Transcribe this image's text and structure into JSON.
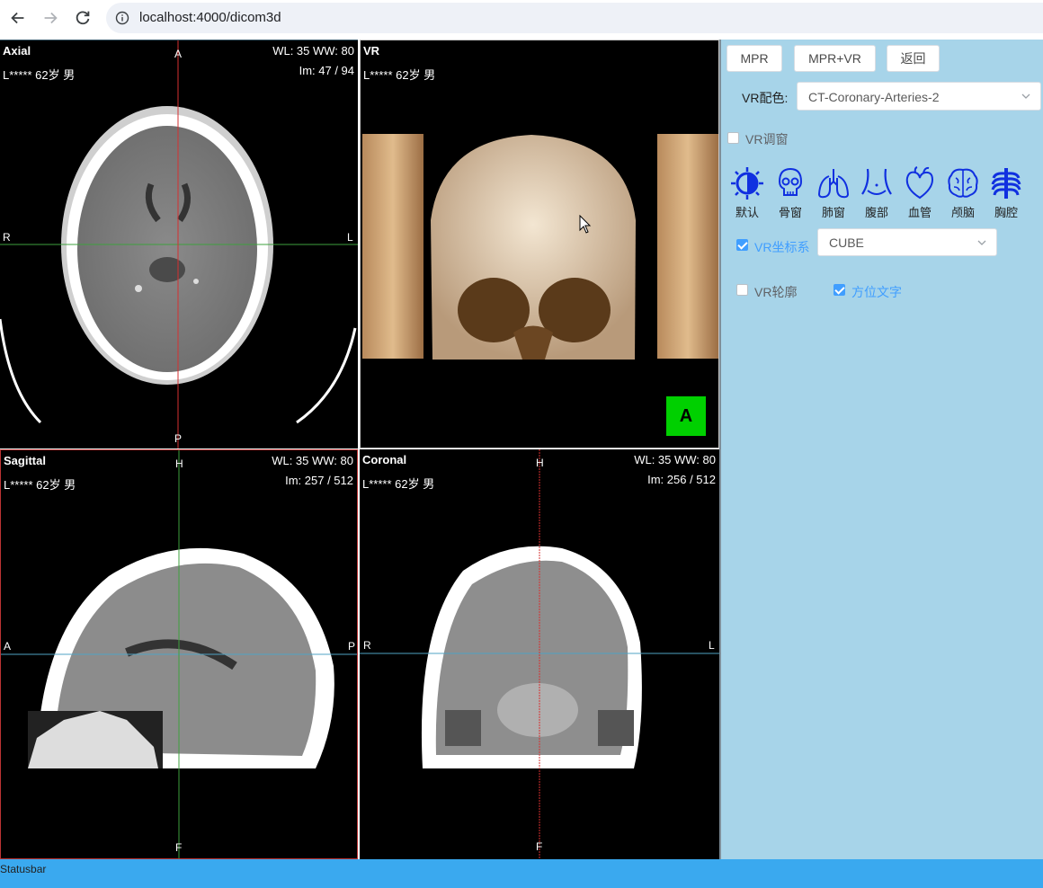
{
  "browser": {
    "url": "localhost:4000/dicom3d"
  },
  "viewports": {
    "axial": {
      "title": "Axial",
      "patient": "L***** 62岁 男",
      "window": "WL: 35 WW: 80",
      "image_index": "Im: 47 / 94",
      "orient": {
        "top": "A",
        "bottom": "P",
        "left": "R",
        "right": "L"
      }
    },
    "vr": {
      "title": "VR",
      "patient": "L***** 62岁 男",
      "orientation_cube": "A"
    },
    "sagittal": {
      "title": "Sagittal",
      "patient": "L***** 62岁 男",
      "window": "WL: 35 WW: 80",
      "image_index": "Im: 257 / 512",
      "orient": {
        "top": "H",
        "bottom": "F",
        "left": "A",
        "right": "P"
      }
    },
    "coronal": {
      "title": "Coronal",
      "patient": "L***** 62岁 男",
      "window": "WL: 35 WW: 80",
      "image_index": "Im: 256 / 512",
      "orient": {
        "top": "H",
        "bottom": "F",
        "left": "R",
        "right": "L"
      }
    }
  },
  "panel": {
    "buttons": {
      "mpr": "MPR",
      "mpr_vr": "MPR+VR",
      "back": "返回"
    },
    "vr_color_label": "VR配色:",
    "vr_color_value": "CT-Coronary-Arteries-2",
    "vr_window": {
      "label": "VR调窗",
      "checked": false
    },
    "presets": [
      {
        "label": "默认",
        "icon": "contrast-icon"
      },
      {
        "label": "骨窗",
        "icon": "skull-icon"
      },
      {
        "label": "肺窗",
        "icon": "lungs-icon"
      },
      {
        "label": "腹部",
        "icon": "abdomen-icon"
      },
      {
        "label": "血管",
        "icon": "heart-icon"
      },
      {
        "label": "颅脑",
        "icon": "brain-icon"
      },
      {
        "label": "胸腔",
        "icon": "ribcage-icon"
      }
    ],
    "vr_axes": {
      "label": "VR坐标系",
      "checked": true
    },
    "vr_axes_value": "CUBE",
    "vr_outline": {
      "label": "VR轮廓",
      "checked": false
    },
    "orientation_text": {
      "label": "方位文字",
      "checked": true
    }
  },
  "statusbar": {
    "text": "Statusbar"
  },
  "colors": {
    "panel_bg": "#a7d4e9",
    "statusbar": "#3aa9ef",
    "accent": "#409eff",
    "cube": "#00d000"
  }
}
